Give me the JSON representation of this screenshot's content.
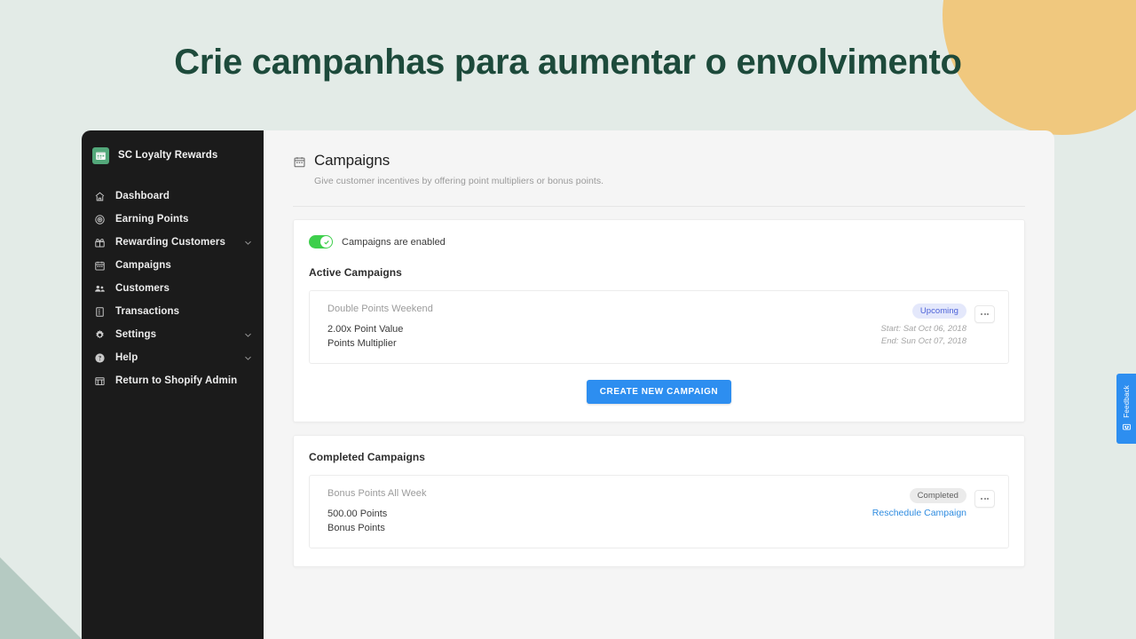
{
  "headline": "Crie campanhas para aumentar o envolvimento",
  "colors": {
    "background": "#e3ebe7",
    "accent_blue": "#2d8ef0",
    "heading_green": "#1d4a3b",
    "circle_yellow": "#f0c87e",
    "triangle_sage": "#b5cac2",
    "toggle_green": "#3ecf4c"
  },
  "sidebar": {
    "brand": {
      "name": "SC Loyalty Rewards",
      "logo_icon": "calendar-logo-icon"
    },
    "items": [
      {
        "label": "Dashboard",
        "icon": "home-icon",
        "expandable": false
      },
      {
        "label": "Earning Points",
        "icon": "target-icon",
        "expandable": false
      },
      {
        "label": "Rewarding Customers",
        "icon": "gift-icon",
        "expandable": true
      },
      {
        "label": "Campaigns",
        "icon": "calendar-icon",
        "expandable": false
      },
      {
        "label": "Customers",
        "icon": "people-icon",
        "expandable": false
      },
      {
        "label": "Transactions",
        "icon": "document-icon",
        "expandable": false
      },
      {
        "label": "Settings",
        "icon": "gear-icon",
        "expandable": true
      },
      {
        "label": "Help",
        "icon": "help-circle-icon",
        "expandable": true
      },
      {
        "label": "Return to Shopify Admin",
        "icon": "store-icon",
        "expandable": false
      }
    ]
  },
  "main": {
    "page_icon": "calendar-icon",
    "page_title": "Campaigns",
    "page_subtitle": "Give customer incentives by offering point multipliers or bonus points.",
    "toggle": {
      "label": "Campaigns are enabled",
      "enabled": true
    },
    "active_section_title": "Active Campaigns",
    "active_campaigns": [
      {
        "name": "Double Points Weekend",
        "value": "2.00x Point Value",
        "type": "Points Multiplier",
        "badge": "Upcoming",
        "start": "Start: Sat Oct 06, 2018",
        "end": "End: Sun Oct 07, 2018"
      }
    ],
    "create_button": "CREATE NEW CAMPAIGN",
    "completed_section_title": "Completed Campaigns",
    "completed_campaigns": [
      {
        "name": "Bonus Points All Week",
        "value": "500.00 Points",
        "type": "Bonus Points",
        "badge": "Completed",
        "link": "Reschedule Campaign"
      }
    ]
  },
  "feedback": {
    "label": "Feedback",
    "icon": "feedback-icon"
  }
}
